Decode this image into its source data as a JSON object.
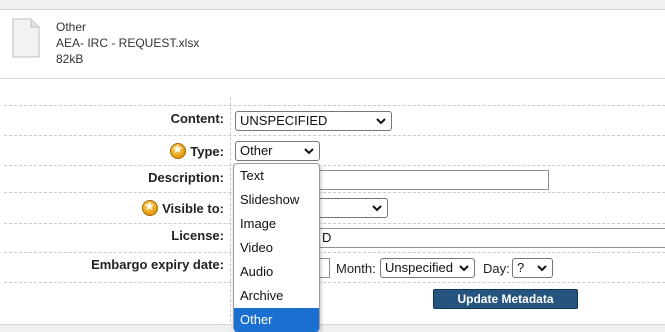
{
  "file": {
    "format": "Other",
    "name": "AEA- IRC - REQUEST.xlsx",
    "size": "82kB",
    "icon": "file-icon"
  },
  "form": {
    "content_label": "Content:",
    "content_value": "UNSPECIFIED",
    "type_label": "Type:",
    "type_value": "Other",
    "description_label": "Description:",
    "description_value": "",
    "visible_label": "Visible to:",
    "license_label": "License:",
    "license_value_partial": "D",
    "embargo_label": "Embargo expiry date:",
    "month_label": "Month:",
    "month_value": "Unspecified",
    "day_label": "Day:",
    "day_value": "?",
    "update_button": "Update Metadata"
  },
  "type_dropdown": {
    "options": [
      "Text",
      "Slideshow",
      "Image",
      "Video",
      "Audio",
      "Archive",
      "Other"
    ],
    "selected": "Other",
    "highlight_color": "#1a6fd1"
  },
  "colors": {
    "button": "#25557f",
    "star": "#e59a0c"
  }
}
